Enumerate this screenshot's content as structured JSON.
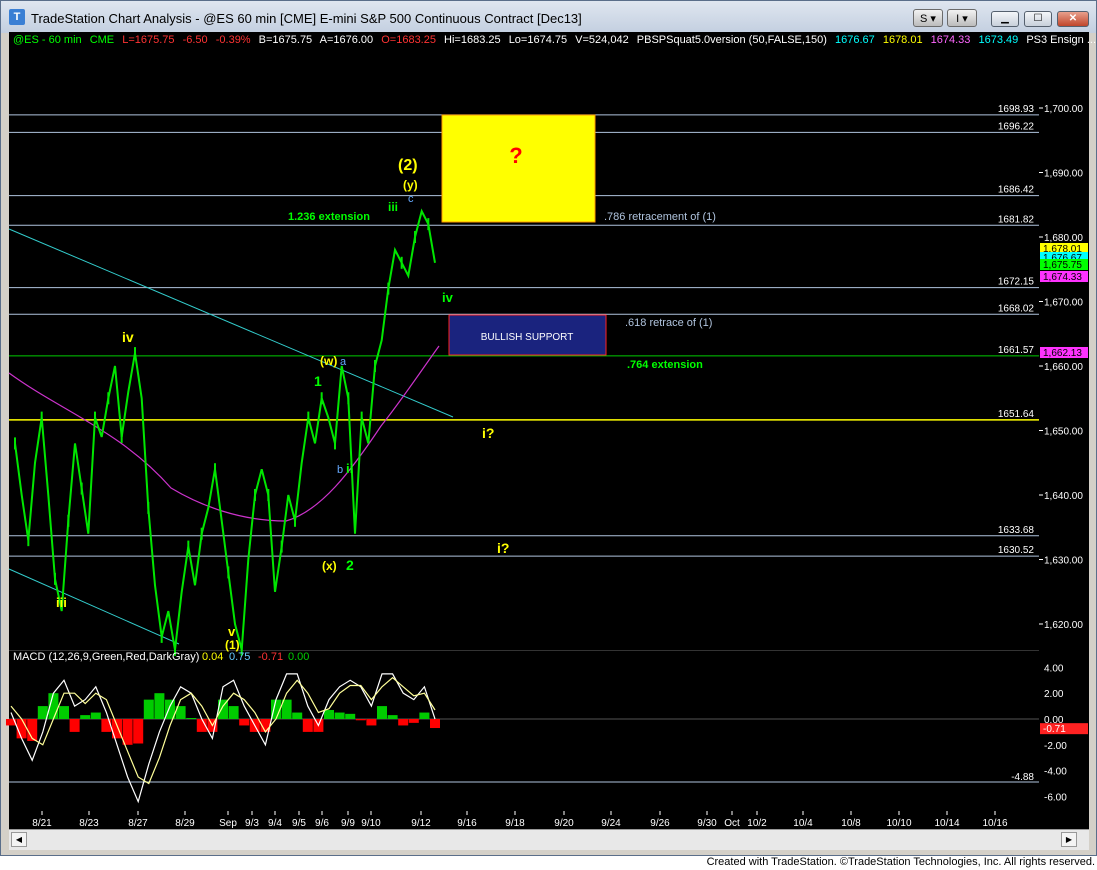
{
  "window": {
    "title": "TradeStation Chart Analysis - @ES 60 min [CME] E-mini S&P 500 Continuous Contract [Dec13]",
    "s_button": "S",
    "i_button": "I"
  },
  "header": {
    "symbol": "@ES - 60 min",
    "exchange": "CME",
    "last": "L=1675.75",
    "change": "-6.50",
    "pct_change": "-0.39%",
    "bid": "B=1675.75",
    "ask": "A=1676.00",
    "open": "O=1683.25",
    "high": "Hi=1683.25",
    "low": "Lo=1674.75",
    "volume": "V=524,042",
    "indicator": "PBSPSquat5.0version (50,FALSE,150)",
    "ind_v1": "1676.67",
    "ind_v2": "1678.01",
    "ind_v3": "1674.33",
    "ind_v4": "1673.49",
    "extra": "PS3 Ensign ..."
  },
  "colors": {
    "price_bars": "#00e600",
    "macd_line": "#ffffff",
    "signal_line": "#ffff99",
    "hist_pos": "#00cc00",
    "hist_neg": "#ff0000",
    "ma": "#cc33cc",
    "trend": "#33cccc",
    "yellow_box": "#ffff00",
    "blue_box": "#1a237e"
  },
  "chart_data": {
    "type": "line",
    "ylim": [
      1615.5,
      1707.5
    ],
    "x_tick_labels": [
      "8/21",
      "8/23",
      "8/27",
      "8/29",
      "Sep",
      "9/3",
      "9/4",
      "9/5",
      "9/6",
      "9/9",
      "9/10",
      "9/12",
      "9/16",
      "9/18",
      "9/20",
      "9/24",
      "9/26",
      "9/30",
      "Oct",
      "10/2",
      "10/4",
      "10/8",
      "10/10",
      "10/14",
      "10/16"
    ],
    "y_tick_labels": [
      "1,700.00",
      "1,690.00",
      "1,680.00",
      "1,670.00",
      "1,660.00",
      "1,650.00",
      "1,640.00",
      "1,630.00",
      "1,620.00"
    ],
    "y_ticks": [
      1700,
      1690,
      1680,
      1670,
      1660,
      1650,
      1640,
      1630,
      1620
    ],
    "price_path": [
      1648,
      1640,
      1633,
      1645,
      1652,
      1640,
      1627,
      1622,
      1636,
      1648,
      1641,
      1634,
      1652,
      1649,
      1655,
      1660,
      1649,
      1656,
      1662,
      1655,
      1638,
      1626,
      1618,
      1622,
      1616,
      1625,
      1632,
      1626,
      1634,
      1638,
      1644,
      1636,
      1628,
      1620,
      1616,
      1630,
      1640,
      1644,
      1640,
      1625,
      1632,
      1640,
      1636,
      1645,
      1652,
      1648,
      1655,
      1652,
      1648,
      1660,
      1655,
      1634,
      1652,
      1648,
      1660,
      1664,
      1672,
      1678,
      1676,
      1674,
      1680,
      1684,
      1682,
      1676
    ],
    "current_price": 1675.75,
    "levels": [
      {
        "label": "1698.93",
        "value": 1698.93
      },
      {
        "label": "1696.22",
        "value": 1696.22
      },
      {
        "label": "1686.42",
        "value": 1686.42
      },
      {
        "label": "1681.82",
        "value": 1681.82
      },
      {
        "label": "1672.15",
        "value": 1672.15
      },
      {
        "label": "1668.02",
        "value": 1668.02
      },
      {
        "label": "1661.57",
        "value": 1661.57
      },
      {
        "label": "1651.64",
        "value": 1651.64
      },
      {
        "label": "1633.68",
        "value": 1633.68
      },
      {
        "label": "1630.52",
        "value": 1630.52
      }
    ],
    "right_tags": [
      "1,678.01",
      "1,676.67",
      "1,675.75",
      "1,674.33",
      "1,662.13"
    ],
    "annotations": {
      "wave2": "(2)",
      "wave_y": "(y)",
      "wave_c": "c",
      "wave_iii": "iii",
      "wave_iv_green": "iv",
      "wave_iv_yellow": "iv",
      "wave_w": "(w)",
      "wave_a": "a",
      "wave_1": "1",
      "wave_b": "b",
      "wave_ii": "ii",
      "wave_x": "(x)",
      "wave_2": "2",
      "wave_iii_low": "iii",
      "wave_v": "v",
      "wave_1_paren": "(1)",
      "i_q1": "i?",
      "i_q2": "i?",
      "question": "?",
      "ext_1236": "1.236 extension",
      "retr_786": ".786 retracement of (1)",
      "retr_618": ".618 retrace of (1)",
      "ext_764": ".764 extension",
      "bullish_support": "BULLISH SUPPORT"
    },
    "macd": {
      "title": "MACD (12,26,9,Green,Red,DarkGray)",
      "v1": "0.04",
      "v2": "0.75",
      "v3": "-0.71",
      "v4": "0.00",
      "ylim": [
        -6.6,
        5.0
      ],
      "y_ticks": [
        4,
        2,
        0,
        -2,
        -4,
        -6
      ],
      "y_tick_labels": [
        "4.00",
        "2.00",
        "0.00",
        "-2.00",
        "-4.00",
        "-6.00"
      ],
      "min_label": "-4.88",
      "min_value": -4.88,
      "current_label": "-0.71",
      "macd_line": [
        0.5,
        -1.5,
        -3.2,
        -1.0,
        2.0,
        3.0,
        1.0,
        1.5,
        2.5,
        0.5,
        -2.0,
        -4.5,
        -6.4,
        -3.5,
        -1.0,
        1.0,
        2.5,
        2.0,
        0.0,
        -1.5,
        2.5,
        3.0,
        1.0,
        -0.5,
        -2.0,
        1.5,
        3.5,
        3.5,
        1.0,
        -0.5,
        1.5,
        2.5,
        3.0,
        2.5,
        1.0,
        3.5,
        3.5,
        2.0,
        1.5,
        2.5,
        0.0
      ],
      "signal_line": [
        1.0,
        0.0,
        -1.5,
        -2.0,
        0.0,
        2.0,
        2.0,
        1.2,
        2.0,
        1.5,
        -0.5,
        -2.5,
        -4.5,
        -5.0,
        -3.0,
        -0.5,
        1.5,
        2.0,
        1.0,
        -0.5,
        1.0,
        2.0,
        1.5,
        0.5,
        -1.0,
        0.0,
        2.0,
        3.0,
        2.0,
        0.5,
        0.8,
        2.0,
        2.6,
        2.6,
        1.5,
        2.5,
        3.2,
        2.5,
        1.8,
        2.0,
        0.7
      ]
    }
  },
  "footer": "Created with TradeStation. ©TradeStation Technologies, Inc. All rights reserved."
}
